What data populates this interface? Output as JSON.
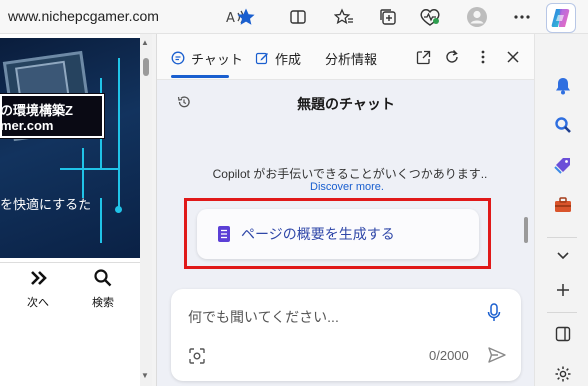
{
  "browser": {
    "url": "www.nichepcgamer.com",
    "icons": [
      "read-aloud-icon",
      "favorite-star-icon",
      "split-screen-icon",
      "favorites-icon",
      "collections-icon",
      "browser-essentials-icon",
      "profile-icon",
      "more-icon",
      "copilot-icon"
    ],
    "accent_color": "#1a5fcf"
  },
  "webpage": {
    "hero_line1": "の環境構築Z",
    "hero_line2": "mer.com",
    "hero_subtitle": "を快適にするた",
    "nav_next_label": "次へ",
    "nav_search_label": "検索"
  },
  "copilot": {
    "tabs": [
      {
        "label": "チャット",
        "icon": "chat-icon",
        "active": true
      },
      {
        "label": "作成",
        "icon": "compose-icon",
        "active": false
      },
      {
        "label": "分析情報",
        "icon": "",
        "active": false
      }
    ],
    "header_icons": [
      "open-in-new-icon",
      "refresh-icon",
      "more-vertical-icon",
      "close-icon"
    ],
    "chat_title": "無題のチャット",
    "help_text": "Copilot がお手伝いできることがいくつかあります..",
    "discover_link": "Discover more.",
    "suggestion_label": "ページの概要を生成する",
    "input_placeholder": "何でも聞いてください...",
    "char_counter": "0/2000",
    "highlight_color": "#e01919"
  },
  "sidebar": {
    "icons": [
      "notifications-icon",
      "search-icon",
      "shopping-tag-icon",
      "tools-icon",
      "chevron-down-icon",
      "add-icon",
      "sidebar-toggle-icon",
      "settings-icon"
    ]
  }
}
